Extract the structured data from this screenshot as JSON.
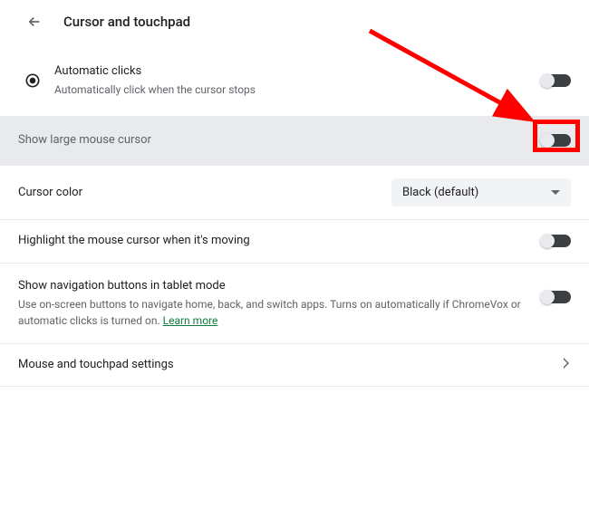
{
  "header": {
    "title": "Cursor and touchpad"
  },
  "rows": {
    "automatic_clicks": {
      "title": "Automatic clicks",
      "sub": "Automatically click when the cursor stops"
    },
    "large_cursor": {
      "title": "Show large mouse cursor"
    },
    "cursor_color": {
      "title": "Cursor color",
      "value": "Black (default)"
    },
    "highlight_moving": {
      "title": "Highlight the mouse cursor when it's moving"
    },
    "tablet_nav": {
      "title": "Show navigation buttons in tablet mode",
      "sub": "Use on-screen buttons to navigate home, back, and switch apps. Turns on automatically if ChromeVox or automatic clicks is turned on. ",
      "link": "Learn more"
    },
    "mouse_touchpad": {
      "title": "Mouse and touchpad settings"
    }
  }
}
